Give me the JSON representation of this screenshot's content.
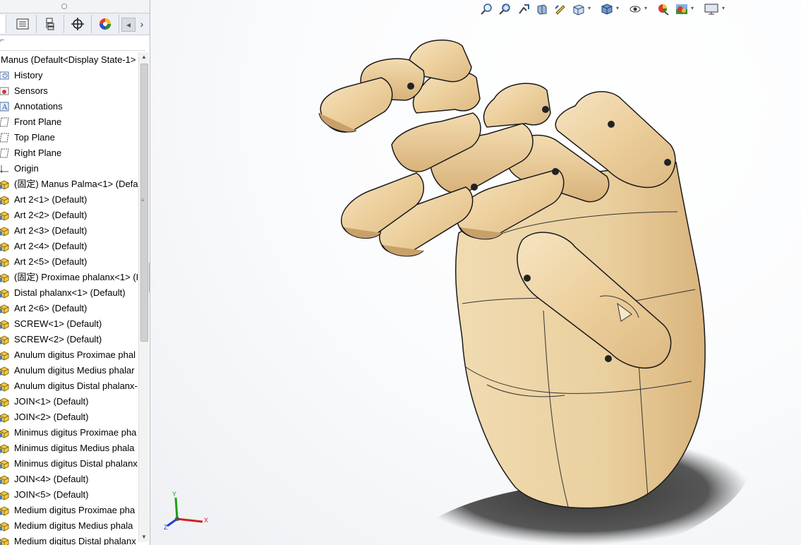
{
  "feature_tree": {
    "root_label": "Manus  (Default<Display State-1>",
    "items": [
      {
        "label": "History",
        "icon": "history-icon"
      },
      {
        "label": "Sensors",
        "icon": "sensors-icon"
      },
      {
        "label": "Annotations",
        "icon": "annotations-icon"
      },
      {
        "label": "Front Plane",
        "icon": "plane-icon"
      },
      {
        "label": "Top Plane",
        "icon": "plane-icon"
      },
      {
        "label": "Right Plane",
        "icon": "plane-icon"
      },
      {
        "label": "Origin",
        "icon": "origin-icon"
      },
      {
        "label": "(固定) Manus Palma<1> (Defa",
        "icon": "part-icon"
      },
      {
        "label": "Art 2<1> (Default)",
        "icon": "part-icon"
      },
      {
        "label": "Art 2<2> (Default)",
        "icon": "part-icon"
      },
      {
        "label": "Art 2<3> (Default)",
        "icon": "part-icon"
      },
      {
        "label": "Art 2<4> (Default)",
        "icon": "part-icon"
      },
      {
        "label": "Art 2<5> (Default)",
        "icon": "part-icon"
      },
      {
        "label": "(固定) Proximae phalanx<1> (I",
        "icon": "part-icon"
      },
      {
        "label": "Distal phalanx<1> (Default)",
        "icon": "part-icon"
      },
      {
        "label": "Art 2<6> (Default)",
        "icon": "part-icon"
      },
      {
        "label": "SCREW<1> (Default)",
        "icon": "part-icon"
      },
      {
        "label": "SCREW<2> (Default)",
        "icon": "part-icon"
      },
      {
        "label": "Anulum digitus Proximae phal",
        "icon": "part-icon"
      },
      {
        "label": "Anulum digitus Medius phalar",
        "icon": "part-icon"
      },
      {
        "label": "Anulum digitus Distal phalanx-",
        "icon": "part-icon"
      },
      {
        "label": "JOIN<1> (Default)",
        "icon": "part-icon"
      },
      {
        "label": "JOIN<2> (Default)",
        "icon": "part-icon"
      },
      {
        "label": "Minimus digitus Proximae pha",
        "icon": "part-icon"
      },
      {
        "label": "Minimus digitus Medius phala",
        "icon": "part-icon"
      },
      {
        "label": "Minimus digitus Distal phalanx",
        "icon": "part-icon"
      },
      {
        "label": "JOIN<4> (Default)",
        "icon": "part-icon"
      },
      {
        "label": "JOIN<5> (Default)",
        "icon": "part-icon"
      },
      {
        "label": "Medium digitus Proximae pha",
        "icon": "part-icon"
      },
      {
        "label": "Medium digitus Medius phala",
        "icon": "part-icon"
      },
      {
        "label": "Medium digitus Distal phalanx",
        "icon": "part-icon"
      }
    ]
  },
  "panel_tabs": [
    "feature-manager-tab",
    "property-manager-tab",
    "configuration-manager-tab",
    "dimxpert-tab",
    "display-manager-tab"
  ],
  "heads_up_toolbar": [
    "zoom-to-fit-icon",
    "zoom-to-area-icon",
    "previous-view-icon",
    "section-view-icon",
    "dynamic-annotation-icon",
    "view-orientation-icon",
    "display-style-icon",
    "hide-show-icon",
    "edit-appearance-icon",
    "apply-scene-icon",
    "view-settings-icon"
  ],
  "triad": {
    "x": "X",
    "y": "Y",
    "z": "Z"
  },
  "colors": {
    "wood": "#ecd3a4",
    "wood_dark": "#c9a66f",
    "outline": "#1a1a1a",
    "panel_bg": "#ffffff",
    "triad_x": "#d42020",
    "triad_y": "#1aa01a",
    "triad_z": "#2040d0"
  }
}
